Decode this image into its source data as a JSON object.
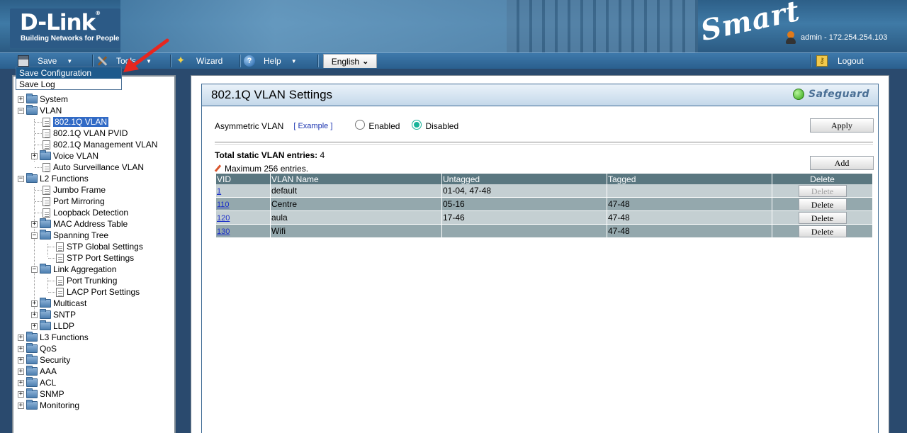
{
  "header": {
    "brand": "D-Link",
    "tagline": "Building Networks for People",
    "product_mark": "Smart",
    "user": "admin - 172.254.254.103"
  },
  "menubar": {
    "save": "Save",
    "tools": "Tools",
    "wizard": "Wizard",
    "help": "Help",
    "language": "English",
    "logout": "Logout"
  },
  "save_menu": {
    "items": [
      "Save Configuration",
      "Save Log"
    ]
  },
  "tree": {
    "items": [
      "System",
      "VLAN",
      "802.1Q VLAN",
      "802.1Q VLAN PVID",
      "802.1Q Management VLAN",
      "Voice VLAN",
      "Auto Surveillance VLAN",
      "L2 Functions",
      "Jumbo Frame",
      "Port Mirroring",
      "Loopback Detection",
      "MAC Address Table",
      "Spanning Tree",
      "STP Global Settings",
      "STP Port Settings",
      "Link Aggregation",
      "Port Trunking",
      "LACP Port Settings",
      "Multicast",
      "SNTP",
      "LLDP",
      "L3 Functions",
      "QoS",
      "Security",
      "AAA",
      "ACL",
      "SNMP",
      "Monitoring"
    ],
    "selected": "802.1Q VLAN"
  },
  "page": {
    "title": "802.1Q VLAN Settings",
    "safeguard": "Safeguard",
    "asym_label": "Asymmetric VLAN",
    "example_link": "[ Example ]",
    "enabled_label": "Enabled",
    "disabled_label": "Disabled",
    "asym_value": "Disabled",
    "apply_button": "Apply",
    "total_label": "Total static VLAN entries:",
    "total_value": "4",
    "max_entries": "Maximum 256 entries.",
    "add_button": "Add"
  },
  "table": {
    "headers": [
      "VID",
      "VLAN Name",
      "Untagged",
      "Tagged",
      "Delete"
    ],
    "rows": [
      {
        "vid": "1",
        "name": "default",
        "untagged": "01-04, 47-48",
        "tagged": "",
        "delete": "Delete",
        "delete_disabled": true
      },
      {
        "vid": "110",
        "name": "Centre",
        "untagged": "05-16",
        "tagged": "47-48",
        "delete": "Delete",
        "delete_disabled": false
      },
      {
        "vid": "120",
        "name": "aula",
        "untagged": "17-46",
        "tagged": "47-48",
        "delete": "Delete",
        "delete_disabled": false
      },
      {
        "vid": "130",
        "name": "Wifi",
        "untagged": "",
        "tagged": "47-48",
        "delete": "Delete",
        "delete_disabled": false
      }
    ]
  },
  "colors": {
    "selected_bg": "#316ac5",
    "table_header": "#5a7780",
    "row_light": "#c4cfd2",
    "row_dark": "#94a8ad",
    "arrow": "#e8261f"
  }
}
